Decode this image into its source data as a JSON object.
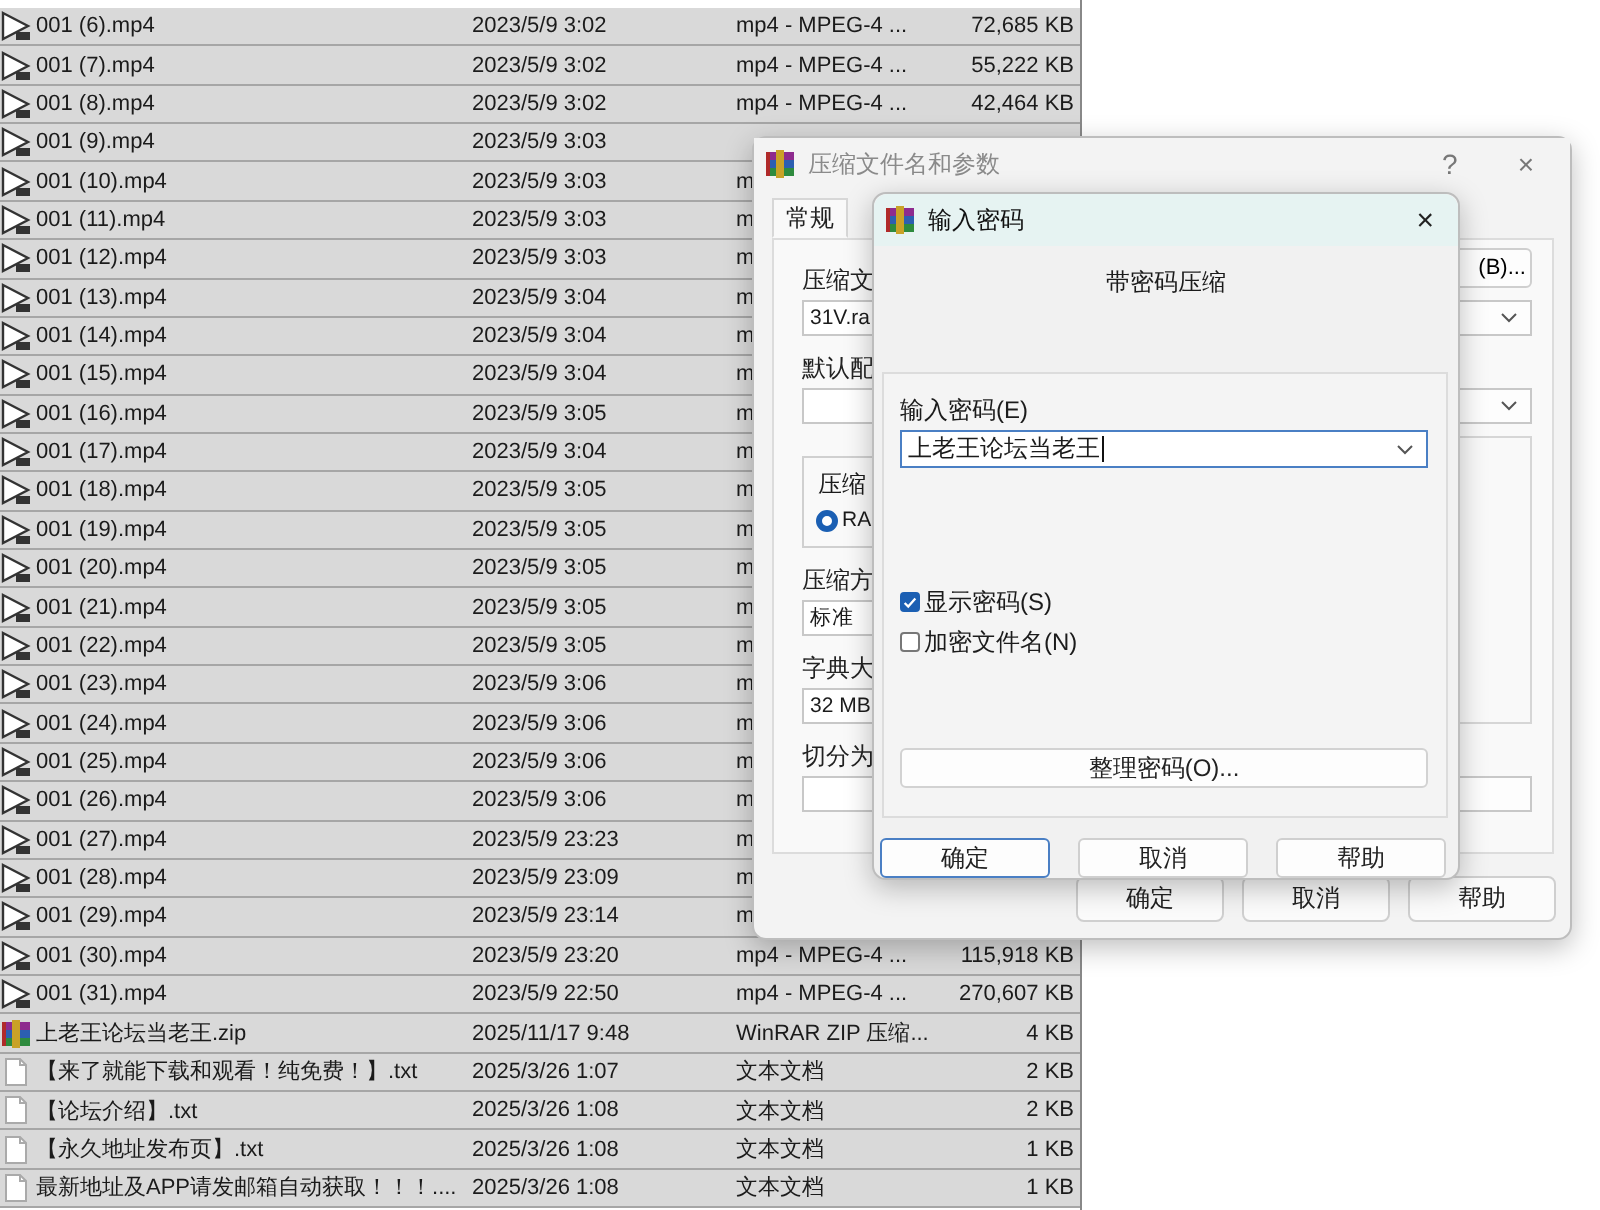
{
  "file_list": {
    "rows": [
      {
        "kind": "video",
        "name": "001 (6).mp4",
        "date": "2023/5/9 3:02",
        "type": "mp4 - MPEG-4 ...",
        "size": "72,685 KB",
        "selected": true
      },
      {
        "kind": "video",
        "name": "001 (7).mp4",
        "date": "2023/5/9 3:02",
        "type": "mp4 - MPEG-4 ...",
        "size": "55,222 KB",
        "selected": true
      },
      {
        "kind": "video",
        "name": "001 (8).mp4",
        "date": "2023/5/9 3:02",
        "type": "mp4 - MPEG-4 ...",
        "size": "42,464 KB",
        "selected": true
      },
      {
        "kind": "video",
        "name": "001 (9).mp4",
        "date": "2023/5/9 3:03",
        "selected": true
      },
      {
        "kind": "video",
        "name": "001 (10).mp4",
        "date": "2023/5/9 3:03",
        "type": "m",
        "selected": true
      },
      {
        "kind": "video",
        "name": "001 (11).mp4",
        "date": "2023/5/9 3:03",
        "type": "m",
        "selected": true
      },
      {
        "kind": "video",
        "name": "001 (12).mp4",
        "date": "2023/5/9 3:03",
        "type": "m",
        "selected": true
      },
      {
        "kind": "video",
        "name": "001 (13).mp4",
        "date": "2023/5/9 3:04",
        "type": "m",
        "selected": true
      },
      {
        "kind": "video",
        "name": "001 (14).mp4",
        "date": "2023/5/9 3:04",
        "type": "m",
        "selected": true
      },
      {
        "kind": "video",
        "name": "001 (15).mp4",
        "date": "2023/5/9 3:04",
        "type": "m",
        "selected": true
      },
      {
        "kind": "video",
        "name": "001 (16).mp4",
        "date": "2023/5/9 3:05",
        "type": "m",
        "selected": true
      },
      {
        "kind": "video",
        "name": "001 (17).mp4",
        "date": "2023/5/9 3:04",
        "type": "m",
        "selected": true
      },
      {
        "kind": "video",
        "name": "001 (18).mp4",
        "date": "2023/5/9 3:05",
        "type": "m",
        "selected": true
      },
      {
        "kind": "video",
        "name": "001 (19).mp4",
        "date": "2023/5/9 3:05",
        "type": "m",
        "selected": true
      },
      {
        "kind": "video",
        "name": "001 (20).mp4",
        "date": "2023/5/9 3:05",
        "type": "m",
        "selected": true
      },
      {
        "kind": "video",
        "name": "001 (21).mp4",
        "date": "2023/5/9 3:05",
        "type": "m",
        "selected": true
      },
      {
        "kind": "video",
        "name": "001 (22).mp4",
        "date": "2023/5/9 3:05",
        "type": "m",
        "selected": true
      },
      {
        "kind": "video",
        "name": "001 (23).mp4",
        "date": "2023/5/9 3:06",
        "type": "m",
        "selected": true
      },
      {
        "kind": "video",
        "name": "001 (24).mp4",
        "date": "2023/5/9 3:06",
        "type": "m",
        "selected": true
      },
      {
        "kind": "video",
        "name": "001 (25).mp4",
        "date": "2023/5/9 3:06",
        "type": "m",
        "selected": true
      },
      {
        "kind": "video",
        "name": "001 (26).mp4",
        "date": "2023/5/9 3:06",
        "type": "m",
        "selected": true
      },
      {
        "kind": "video",
        "name": "001 (27).mp4",
        "date": "2023/5/9 23:23",
        "type": "m",
        "selected": true
      },
      {
        "kind": "video",
        "name": "001 (28).mp4",
        "date": "2023/5/9 23:09",
        "type": "m",
        "selected": true
      },
      {
        "kind": "video",
        "name": "001 (29).mp4",
        "date": "2023/5/9 23:14",
        "type": "m",
        "selected": true
      },
      {
        "kind": "video",
        "name": "001 (30).mp4",
        "date": "2023/5/9 23:20",
        "type": "mp4 - MPEG-4 ...",
        "size": "115,918 KB",
        "selected": true
      },
      {
        "kind": "video",
        "name": "001 (31).mp4",
        "date": "2023/5/9 22:50",
        "type": "mp4 - MPEG-4 ...",
        "size": "270,607 KB",
        "selected": true
      },
      {
        "kind": "archive",
        "name": "上老王论坛当老王.zip",
        "date": "2025/11/17 9:48",
        "type": "WinRAR ZIP 压缩...",
        "size": "4 KB",
        "selected": true
      },
      {
        "kind": "text",
        "name": "【来了就能下载和观看！纯免费！】.txt",
        "date": "2025/3/26 1:07",
        "type": "文本文档",
        "size": "2 KB",
        "selected": true
      },
      {
        "kind": "text",
        "name": "【论坛介绍】.txt",
        "date": "2025/3/26 1:08",
        "type": "文本文档",
        "size": "2 KB",
        "selected": true
      },
      {
        "kind": "text",
        "name": "【永久地址发布页】.txt",
        "date": "2025/3/26 1:08",
        "type": "文本文档",
        "size": "1 KB",
        "selected": true
      },
      {
        "kind": "text",
        "name": "最新地址及APP请发邮箱自动获取！！！....",
        "date": "2025/3/26 1:08",
        "type": "文本文档",
        "size": "1 KB",
        "selected": true
      }
    ]
  },
  "archive_dialog": {
    "title": "压缩文件名和参数",
    "active": false,
    "help": "?",
    "close": "×",
    "tabs": [
      {
        "label": "常规",
        "selected": true
      }
    ],
    "left_column": [
      {
        "kind": "label",
        "text": "压缩文"
      },
      {
        "kind": "field",
        "value": "31V.ra"
      },
      {
        "kind": "label",
        "text": "默认配"
      },
      {
        "kind": "field"
      },
      {
        "kind": "group",
        "legend": "压缩",
        "radio": {
          "label": "RA",
          "selected": true
        }
      },
      {
        "kind": "label",
        "text": "压缩方"
      },
      {
        "kind": "field",
        "value": "标准"
      },
      {
        "kind": "label",
        "text": "字典大"
      },
      {
        "kind": "field",
        "value": "32 MB"
      },
      {
        "kind": "label",
        "text": "切分为"
      },
      {
        "kind": "field"
      }
    ],
    "right_column": [
      {
        "kind": "button",
        "label": "(B)..."
      },
      {
        "kind": "dropdown"
      },
      {
        "kind": "dropdown"
      },
      {
        "kind": "panel"
      },
      {
        "kind": "field"
      }
    ],
    "buttons": [
      "确定",
      "取消",
      "帮助"
    ]
  },
  "password_dialog": {
    "title": "输入密码",
    "active": true,
    "close": "×",
    "heading": "带密码压缩",
    "password_label": "输入密码(E)",
    "password_value": "上老王论坛当老王",
    "options": [
      {
        "label": "显示密码(S)",
        "checked": true
      },
      {
        "label": "加密文件名(N)",
        "checked": false
      }
    ],
    "manage_button": "整理密码(O)...",
    "buttons": [
      {
        "label": "确定",
        "focused": true
      },
      {
        "label": "取消",
        "focused": false
      },
      {
        "label": "帮助",
        "focused": false
      }
    ]
  }
}
